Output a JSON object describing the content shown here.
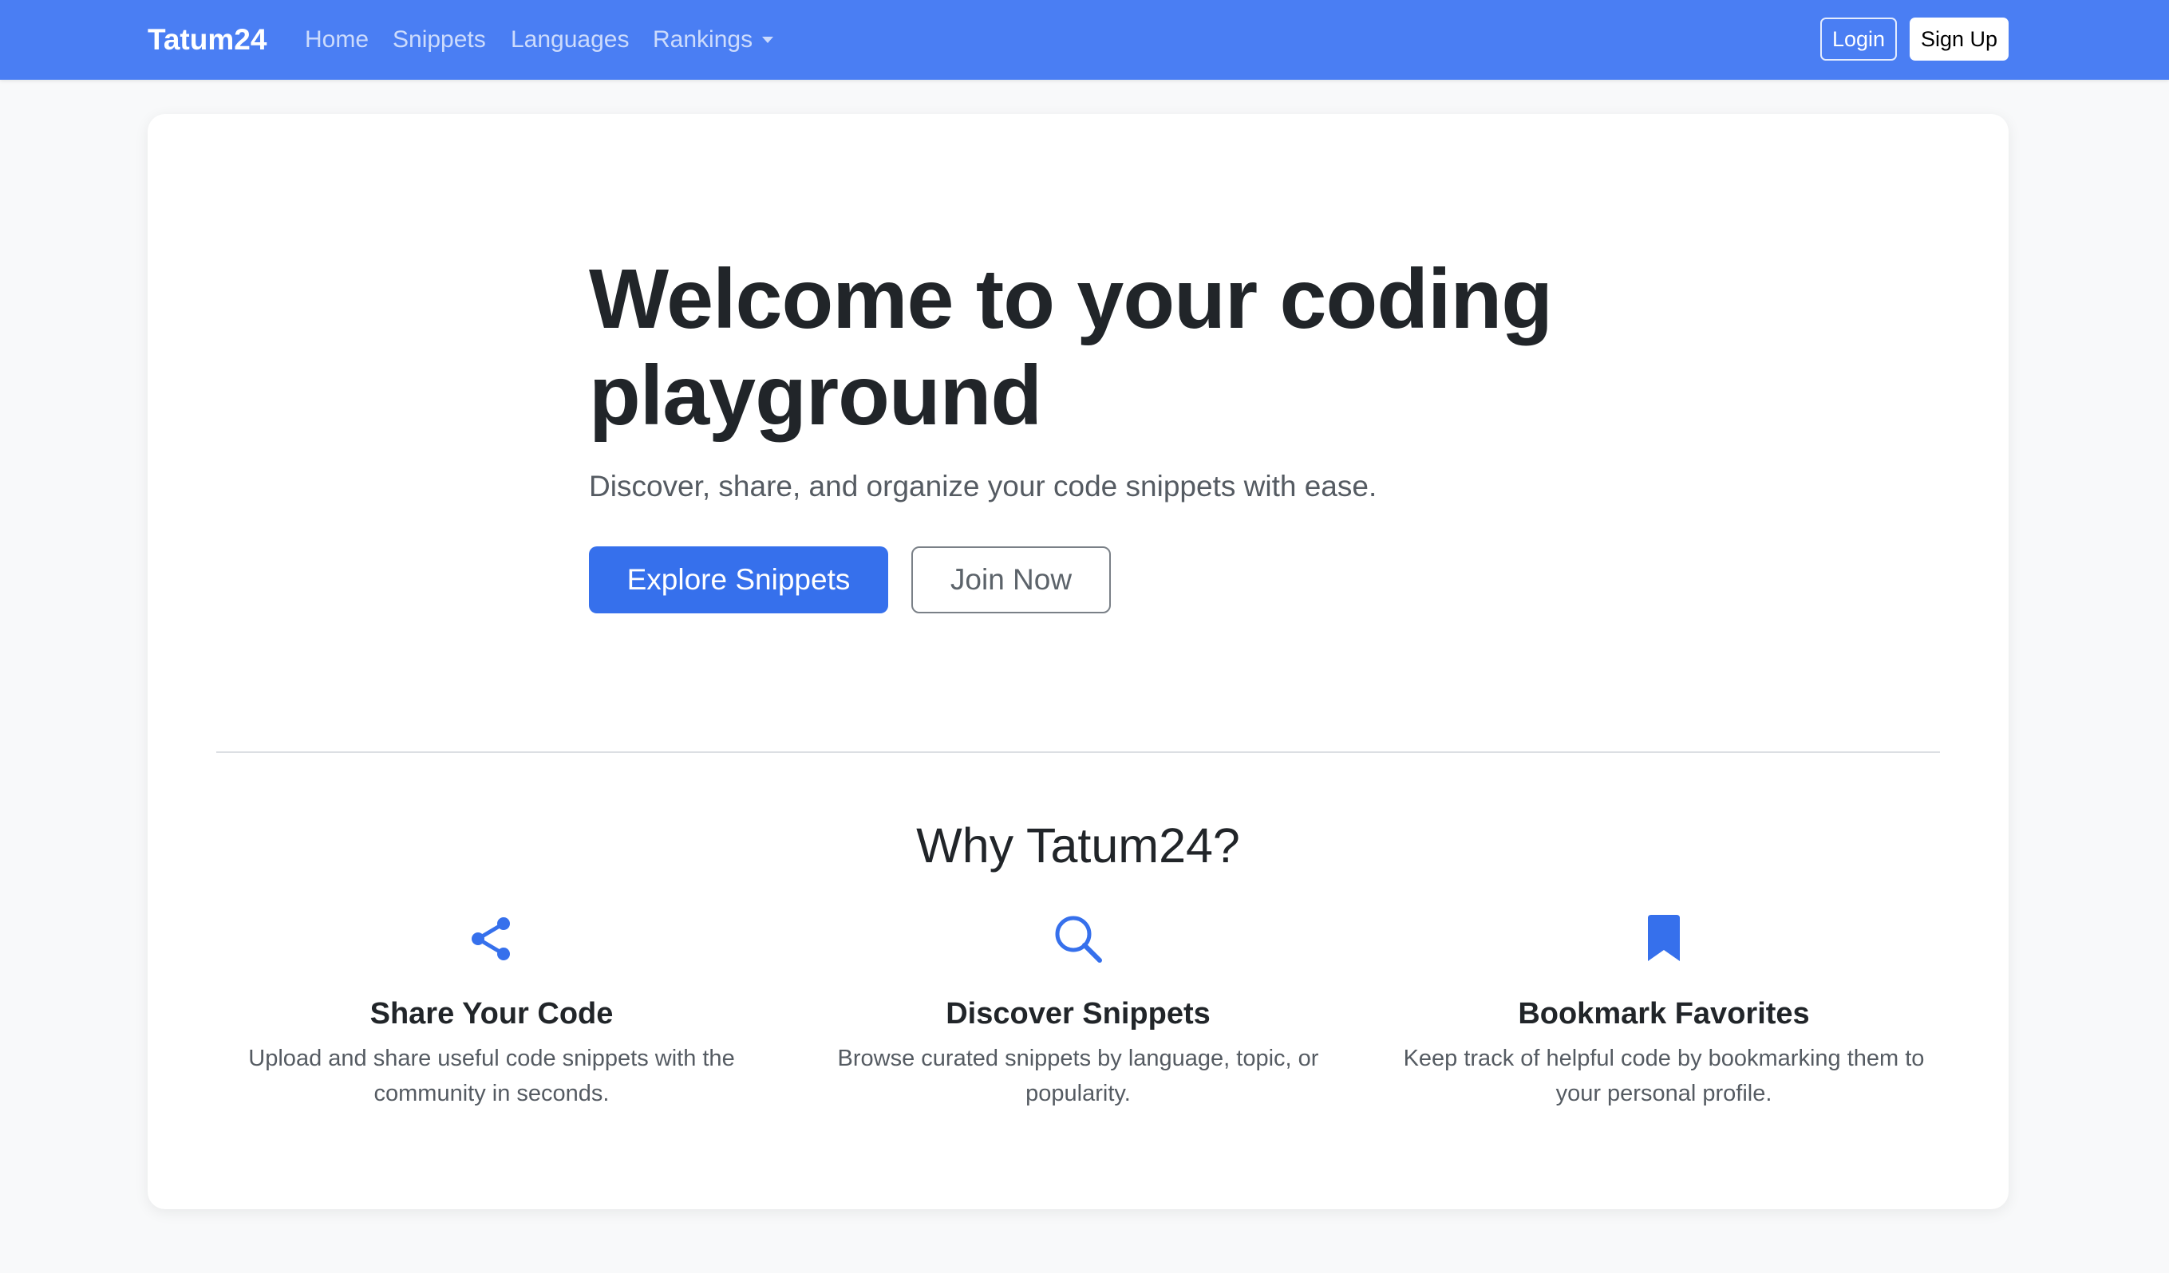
{
  "navbar": {
    "brand": "Tatum24",
    "links": [
      "Home",
      "Snippets",
      "Languages",
      "Rankings"
    ],
    "login_label": "Login",
    "signup_label": "Sign Up",
    "background_color": "#4A7EF3"
  },
  "hero": {
    "title": "Welcome to your coding playground",
    "subtitle": "Discover, share, and organize your code snippets with ease.",
    "primary_button": "Explore Snippets",
    "secondary_button": "Join Now",
    "accent_color": "#3670EC"
  },
  "why": {
    "title": "Why Tatum24?",
    "features": [
      {
        "icon": "share-icon",
        "title": "Share Your Code",
        "text": "Upload and share useful code snippets with the community in seconds."
      },
      {
        "icon": "search-icon",
        "title": "Discover Snippets",
        "text": "Browse curated snippets by language, topic, or popularity."
      },
      {
        "icon": "bookmark-icon",
        "title": "Bookmark Favorites",
        "text": "Keep track of helpful code by bookmarking them to your personal profile."
      }
    ]
  }
}
